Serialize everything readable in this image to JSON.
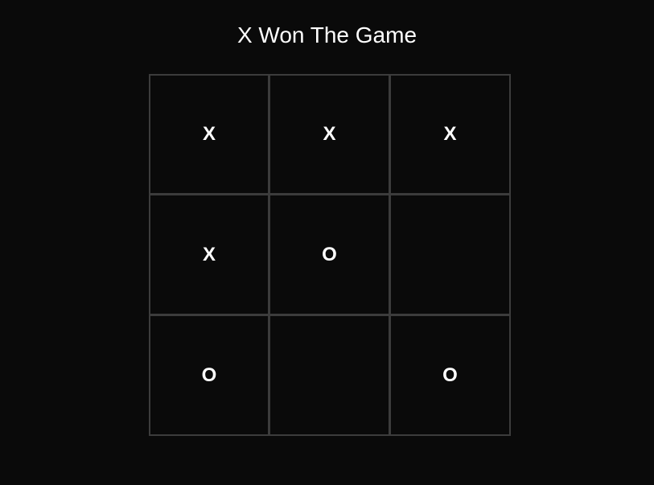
{
  "status": "X Won The Game",
  "board": {
    "cells": [
      {
        "value": "X"
      },
      {
        "value": "X"
      },
      {
        "value": "X"
      },
      {
        "value": "X"
      },
      {
        "value": "O"
      },
      {
        "value": ""
      },
      {
        "value": "O"
      },
      {
        "value": ""
      },
      {
        "value": "O"
      }
    ]
  }
}
